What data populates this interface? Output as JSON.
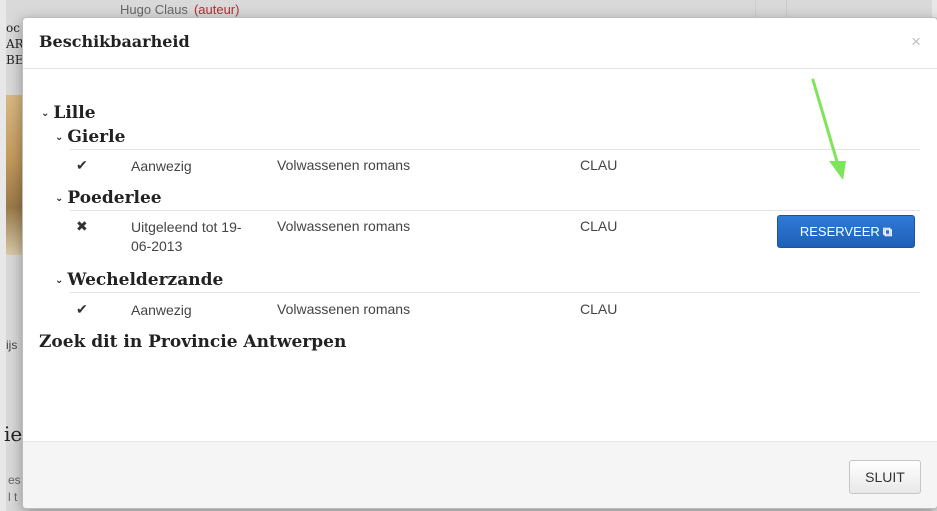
{
  "background": {
    "author": "Hugo Claus",
    "author_role": "(auteur)",
    "left_letters": [
      "oc",
      "AR",
      "BE"
    ],
    "left_word": "ijs",
    "big_letters": "ie",
    "small1": "es",
    "small2": "l t"
  },
  "modal": {
    "title": "Beschikbaarheid",
    "close_symbol": "×",
    "chevron": "⌄",
    "library": "Lille",
    "branches": [
      {
        "name": "Gierle",
        "status_icon": "✔",
        "status": "Aanwezig",
        "category": "Volwassenen romans",
        "code": "CLAU"
      },
      {
        "name": "Poederlee",
        "status_icon": "✖",
        "status": "Uitgeleend tot 19-06-2013",
        "category": "Volwassenen romans",
        "code": "CLAU",
        "action_label": "RESERVEER",
        "action_icon": "⧉"
      },
      {
        "name": "Wechelderzande",
        "status_icon": "✔",
        "status": "Aanwezig",
        "category": "Volwassenen romans",
        "code": "CLAU"
      }
    ],
    "search_link": "Zoek dit in Provincie Antwerpen",
    "close_button": "SLUIT"
  },
  "annotation": {
    "arrow_color": "#7ee55a"
  }
}
